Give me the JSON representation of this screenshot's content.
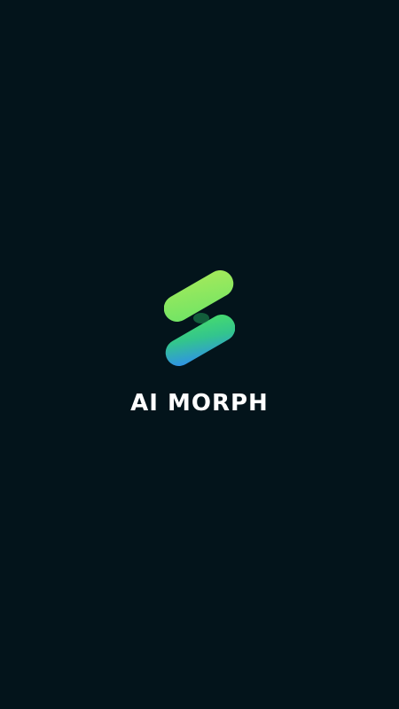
{
  "splash": {
    "app_name": "AI MORPH",
    "logo_icon": "morph-s-logo-icon",
    "background_color": "#03141b",
    "text_color": "#ffffff",
    "logo_gradient": {
      "top": "#8be85e",
      "middle": "#3cd67a",
      "bottom": "#2f8cf2"
    }
  }
}
